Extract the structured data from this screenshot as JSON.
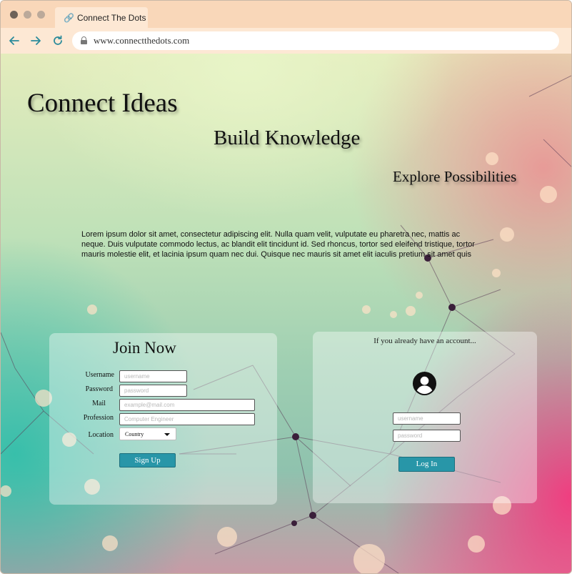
{
  "browser": {
    "tab_title": "Connect The Dots",
    "url": "www.connectthedots.com",
    "traffic_lights": [
      "#6e6259",
      "#bba99a",
      "#bba99a"
    ]
  },
  "hero": {
    "heading_1": "Connect Ideas",
    "heading_2": "Build Knowledge",
    "heading_3": "Explore Possibilities",
    "paragraph": "Lorem ipsum dolor sit amet, consectetur adipiscing elit. Nulla quam velit, vulputate eu pharetra nec, mattis ac neque. Duis vulputate commodo lectus, ac blandit elit tincidunt id. Sed rhoncus, tortor sed eleifend tristique, tortor mauris molestie elit, et lacinia ipsum quam nec dui. Quisque nec mauris sit amet elit iaculis pretium sit amet quis"
  },
  "signup": {
    "title": "Join Now",
    "username_label": "Username",
    "username_placeholder": "username",
    "password_label": "Password",
    "password_placeholder": "password",
    "mail_label": "Mail",
    "mail_placeholder": "example@mail.com",
    "profession_label": "Profession",
    "profession_placeholder": "Computer Engineer",
    "location_label": "Location",
    "location_value": "Country",
    "submit_label": "Sign Up"
  },
  "login": {
    "hint": "If you already have an account...",
    "username_placeholder": "username",
    "password_placeholder": "password",
    "submit_label": "Log In"
  },
  "colors": {
    "accent": "#2896a8"
  },
  "icons": {
    "back": "arrow-left-icon",
    "forward": "arrow-right-icon",
    "reload": "reload-icon",
    "lock": "lock-icon",
    "tab": "link-icon",
    "account": "user-circle-icon"
  }
}
